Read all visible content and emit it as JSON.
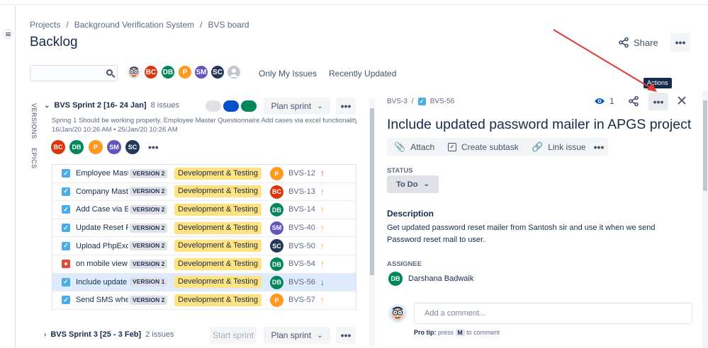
{
  "breadcrumb": [
    "Projects",
    "Background Verification System",
    "BVS board"
  ],
  "page_title": "Backlog",
  "header": {
    "share_label": "Share"
  },
  "search": {
    "placeholder": ""
  },
  "avatars": [
    {
      "initials": "BC",
      "color": "#DE350B"
    },
    {
      "initials": "DB",
      "color": "#00875A"
    },
    {
      "initials": "P",
      "color": "#FF991F"
    },
    {
      "initials": "SM",
      "color": "#6554C0"
    },
    {
      "initials": "SC",
      "color": "#253858"
    }
  ],
  "filters": {
    "only_my_issues": "Only My Issues",
    "recently_updated": "Recently Updated"
  },
  "side_tabs": {
    "versions": "VERSIONS",
    "epics": "EPICS"
  },
  "sprint2": {
    "name": "BVS Sprint 2 [16- 24 Jan]",
    "count": "8 issues",
    "plan_label": "Plan sprint",
    "goal": "Spring 1 Should be working properly. Employee Master Questionnaire Add cases via excel functionality...",
    "dates": "16/Jan/20 10:26 AM • 25/Jan/20 10:26 AM",
    "pill_colors": [
      "#DFE1E6",
      "#0052CC",
      "#00875A"
    ]
  },
  "issues": [
    {
      "summary": "Employee Mast",
      "version": "VERSION 2",
      "epic": "Development & Testing",
      "assignee": "P",
      "assignee_color": "#FF991F",
      "key": "BVS-12",
      "priority": "↑",
      "priority_color": "#DE350B",
      "type": "story"
    },
    {
      "summary": "Company Mast",
      "version": "VERSION 2",
      "epic": "Development & Testing",
      "assignee": "BC",
      "assignee_color": "#DE350B",
      "key": "BVS-13",
      "priority": "↑",
      "priority_color": "#FF7452",
      "type": "story"
    },
    {
      "summary": "Add Case via Ex",
      "version": "VERSION 2",
      "epic": "Development & Testing",
      "assignee": "DB",
      "assignee_color": "#00875A",
      "key": "BVS-14",
      "priority": "↑",
      "priority_color": "#FF991F",
      "type": "story"
    },
    {
      "summary": "Update Reset P",
      "version": "VERSION 2",
      "epic": "Development & Testing",
      "assignee": "SM",
      "assignee_color": "#6554C0",
      "key": "BVS-40",
      "priority": "↑",
      "priority_color": "#FF991F",
      "type": "story"
    },
    {
      "summary": "Upload PhpExc",
      "version": "VERSION 2",
      "epic": "Development & Testing",
      "assignee": "SC",
      "assignee_color": "#253858",
      "key": "BVS-50",
      "priority": "↑",
      "priority_color": "#FF991F",
      "type": "story"
    },
    {
      "summary": "on mobile view",
      "version": "VERSION 2",
      "epic": "Development & Testing",
      "assignee": "DB",
      "assignee_color": "#00875A",
      "key": "BVS-54",
      "priority": "↑",
      "priority_color": "#FF991F",
      "type": "bug"
    },
    {
      "summary": "Include update",
      "version": "VERSION 1",
      "epic": "Development & Testing",
      "assignee": "DB",
      "assignee_color": "#00875A",
      "key": "BVS-56",
      "priority": "↓",
      "priority_color": "#00875A",
      "type": "story",
      "selected": true
    },
    {
      "summary": "Send SMS wher",
      "version": "VERSION 2",
      "epic": "Development & Testing",
      "assignee": "P",
      "assignee_color": "#FF991F",
      "key": "BVS-57",
      "priority": "↑",
      "priority_color": "#FF991F",
      "type": "story"
    }
  ],
  "sprint3": {
    "name": "BVS Sprint 3 [25 - 3 Feb]",
    "count": "2 issues",
    "start_label": "Start sprint",
    "plan_label": "Plan sprint"
  },
  "detail": {
    "parent_key": "BVS-3",
    "key": "BVS-56",
    "watch_count": "1",
    "tooltip": "Actions",
    "title": "Include updated password mailer in APGS project",
    "attach_label": "Attach",
    "subtask_label": "Create subtask",
    "link_label": "Link issue",
    "status_label": "STATUS",
    "status_value": "To Do",
    "description_heading": "Description",
    "description": "Get updated password reset mailer from Santosh sir and use it when we send Password reset mail to user.",
    "assignee_label": "ASSIGNEE",
    "assignee_initials": "DB",
    "assignee_name": "Darshana Badwaik",
    "comment_placeholder": "Add a comment...",
    "protip_prefix": "Pro tip:",
    "protip_press": "press",
    "protip_key": "M",
    "protip_suffix": "to comment"
  }
}
